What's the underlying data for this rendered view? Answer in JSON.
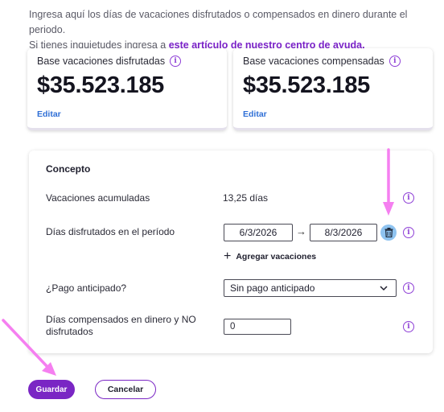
{
  "intro": {
    "line1": "Ingresa aquí los días de vacaciones disfrutados o compensados en dinero durante el periodo.",
    "line2_prefix": "Si tienes inquietudes ingresa a ",
    "link": "este artículo de nuestro centro de ayuda."
  },
  "cards": [
    {
      "title": "Base vacaciones disfrutadas",
      "amount": "$35.523.185",
      "edit": "Editar"
    },
    {
      "title": "Base vacaciones compensadas",
      "amount": "$35.523.185",
      "edit": "Editar"
    }
  ],
  "panel": {
    "title": "Concepto",
    "accumulated_label": "Vacaciones acumuladas",
    "accumulated_value": "13,25 días",
    "enjoyed_label": "Días disfrutados en el período",
    "date_start": "6/3/2026",
    "date_arrow": "→",
    "date_end": "8/3/2026",
    "add_vacation": "Agregar vacaciones",
    "advance_label": "¿Pago anticipado?",
    "advance_value": "Sin pago anticipado",
    "compensated_label_line1": "Días compensados en dinero y NO",
    "compensated_label_line2": "disfrutados",
    "compensated_value": "0"
  },
  "actions": {
    "save": "Guardar",
    "cancel": "Cancelar"
  },
  "icons": {
    "info": "i",
    "info_name": "info-icon",
    "trash": "trash-icon",
    "chevron": "chevron-down-icon",
    "plus": "+"
  },
  "colors": {
    "accent": "#7a26c4",
    "link": "#2f6fd6",
    "annotation_arrow": "#f57ff0",
    "trash_bg": "#8ec3f0"
  }
}
